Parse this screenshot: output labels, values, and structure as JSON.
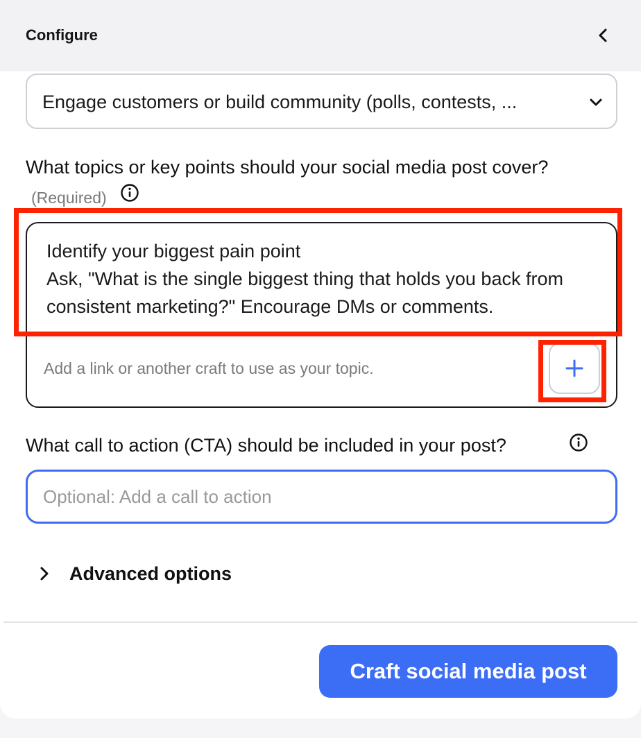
{
  "header": {
    "title": "Configure",
    "collapse_icon": "chevron-left-icon"
  },
  "goal_select": {
    "value": "Engage customers or build community (polls, contests, ...",
    "icon": "chevron-down-icon"
  },
  "topics": {
    "label": "What topics or key points should your social media post cover?",
    "required_label": "(Required)",
    "info_icon": "info-icon",
    "text": "Identify your biggest pain point\nAsk, \"What is the single biggest thing that holds you back from consistent marketing?\" Encourage DMs or comments.",
    "link_hint": "Add a link or another craft to use as your topic.",
    "add_icon": "plus-icon"
  },
  "cta": {
    "label": "What call to action (CTA) should be included in your post?",
    "info_icon": "info-icon",
    "placeholder": "Optional: Add a call to action",
    "value": ""
  },
  "advanced": {
    "label": "Advanced options",
    "icon": "chevron-right-icon"
  },
  "submit": {
    "label": "Craft social media post"
  },
  "colors": {
    "accent": "#3b6ef5",
    "highlight": "#ff2200",
    "border": "#cfcfd4"
  }
}
